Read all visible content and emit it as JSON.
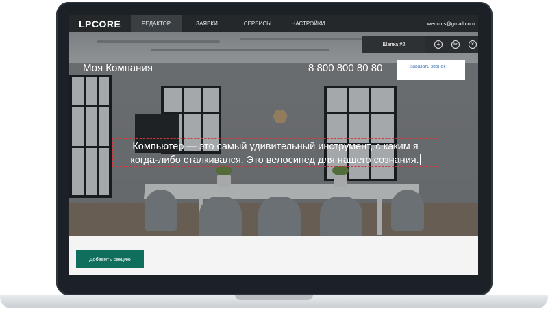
{
  "topbar": {
    "logo": "LPCORE",
    "nav": [
      "РЕДАКТОР",
      "ЗАЯВКИ",
      "СЕРВИСЫ",
      "НАСТРОЙКИ"
    ],
    "active_nav": "РЕДАКТОР",
    "user_email": "wencms@gmail.com"
  },
  "header_section": {
    "company_name": "Моя Компания",
    "phone": "8 800 800 80 80",
    "cta_label": "заказать звонок"
  },
  "section_toolbar": {
    "section_name": "Шапка #2",
    "icons": [
      "plus-icon",
      "scissors-icon",
      "close-icon"
    ]
  },
  "hero": {
    "text_line1": "Компьютер — это самый удивительный инструмент, с каким я",
    "text_line2": "когда-либо сталкивался. Это велосипед для нашего сознания."
  },
  "bottom": {
    "add_section_label": "Добавить секцию"
  },
  "colors": {
    "accent_green": "#0f6e5c",
    "edit_border_red": "#d6353a",
    "topbar_bg": "#24282b"
  }
}
